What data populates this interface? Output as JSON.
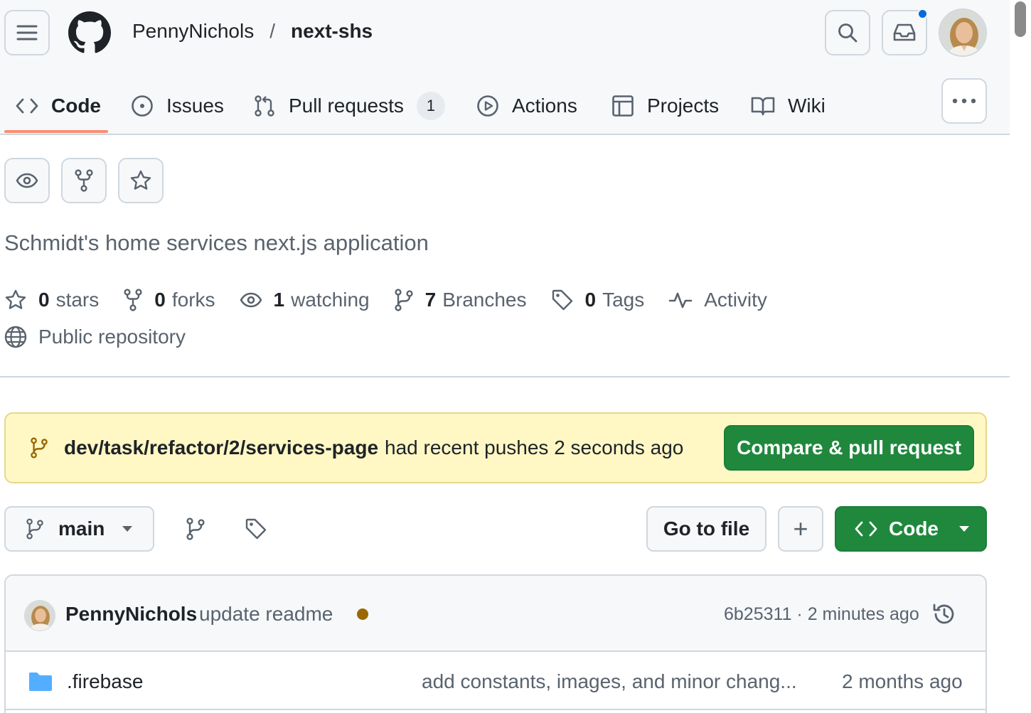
{
  "header": {
    "owner": "PennyNichols",
    "separator": "/",
    "repo": "next-shs"
  },
  "tabs": [
    {
      "label": "Code",
      "icon": "code-icon",
      "active": true
    },
    {
      "label": "Issues",
      "icon": "issue-opened-icon"
    },
    {
      "label": "Pull requests",
      "icon": "git-pull-request-icon",
      "count": "1"
    },
    {
      "label": "Actions",
      "icon": "play-icon"
    },
    {
      "label": "Projects",
      "icon": "table-icon"
    },
    {
      "label": "Wiki",
      "icon": "book-icon"
    }
  ],
  "repo": {
    "description": "Schmidt's home services next.js application",
    "stats": {
      "stars_count": "0",
      "stars_label": "stars",
      "forks_count": "0",
      "forks_label": "forks",
      "watching_count": "1",
      "watching_label": "watching",
      "branches_count": "7",
      "branches_label": "Branches",
      "tags_count": "0",
      "tags_label": "Tags",
      "activity_label": "Activity"
    },
    "visibility": "Public repository"
  },
  "banner": {
    "branch": "dev/task/refactor/2/services-page",
    "message": "had recent pushes 2 seconds ago",
    "button": "Compare & pull request"
  },
  "toolbar": {
    "branch": "main",
    "go_to_file": "Go to file",
    "add": "+",
    "code": "Code"
  },
  "latest_commit": {
    "author": "PennyNichols",
    "message": "update readme",
    "meta": "6b25311 · 2 minutes ago"
  },
  "files": [
    {
      "name": ".firebase",
      "type": "folder",
      "message": "add constants, images, and minor chang...",
      "age": "2 months ago"
    }
  ],
  "colors": {
    "accent_green": "#1f883d",
    "underline": "#fd8c73",
    "banner_bg": "#fff8c5",
    "notification": "#0969da",
    "folder": "#54aeff"
  }
}
